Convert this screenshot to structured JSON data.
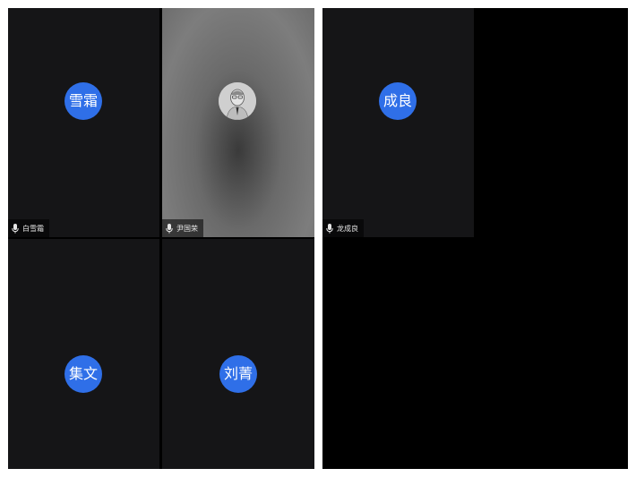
{
  "colors": {
    "avatar_blue": "#2f6fe8",
    "tile_bg": "#151517",
    "panel_bg": "#000000"
  },
  "left_panel": {
    "tiles": [
      {
        "avatar_text": "雪霜",
        "name": "白雪霜",
        "mic_icon": "microphone-icon"
      },
      {
        "avatar_text": "",
        "avatar_image": "portrait-photo",
        "name": "尹国荣",
        "mic_icon": "microphone-icon"
      },
      {
        "avatar_text": "集文",
        "name": ""
      },
      {
        "avatar_text": "刘菁",
        "name": ""
      }
    ]
  },
  "right_panel": {
    "tiles": [
      {
        "avatar_text": "成良",
        "name": "龙成良",
        "mic_icon": "microphone-icon"
      }
    ]
  }
}
